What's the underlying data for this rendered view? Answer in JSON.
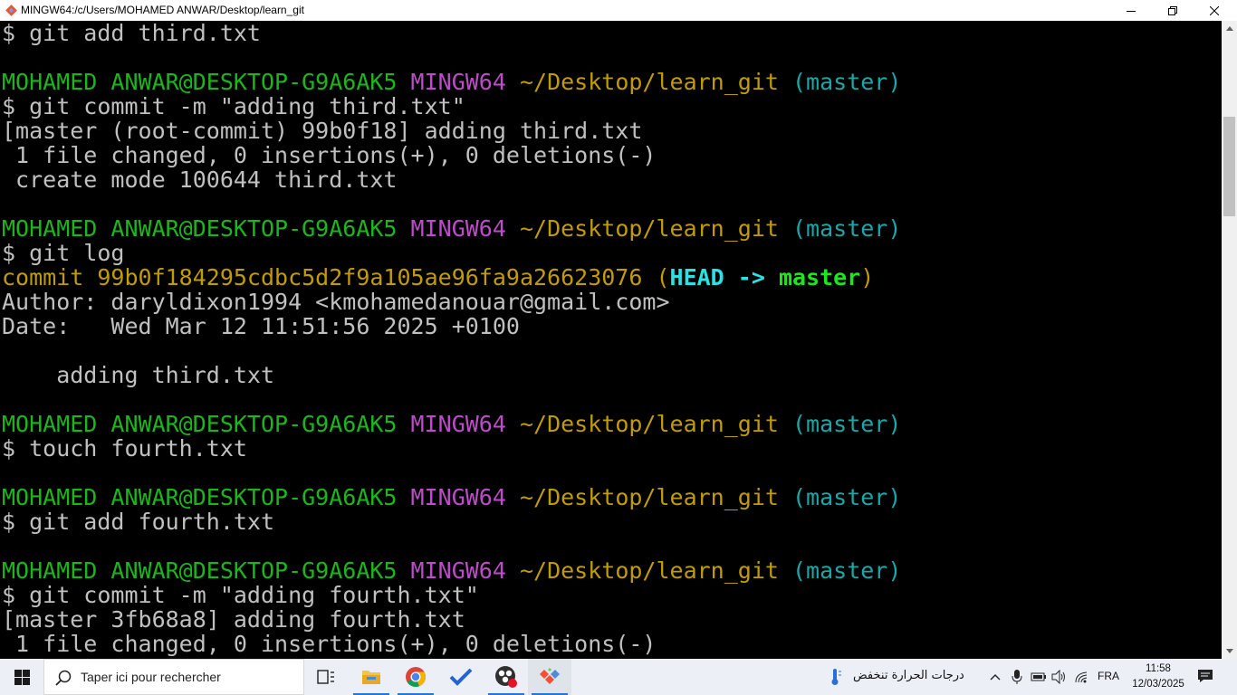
{
  "window": {
    "title": "MINGW64:/c/Users/MOHAMED ANWAR/Desktop/learn_git",
    "minimize_icon": "minimize-icon",
    "restore_icon": "restore-icon",
    "close_icon": "close-icon"
  },
  "terminal": {
    "lines": [
      [
        {
          "c": "default",
          "t": "$ git add third.txt"
        }
      ],
      [],
      [
        {
          "c": "user",
          "t": "MOHAMED ANWAR@DESKTOP-G9A6AK5 "
        },
        {
          "c": "msys",
          "t": "MINGW64 "
        },
        {
          "c": "path",
          "t": "~/Desktop/learn_git "
        },
        {
          "c": "branch",
          "t": "(master)"
        }
      ],
      [
        {
          "c": "default",
          "t": "$ git commit -m \"adding third.txt\""
        }
      ],
      [
        {
          "c": "default",
          "t": "[master (root-commit) 99b0f18] adding third.txt"
        }
      ],
      [
        {
          "c": "default",
          "t": " 1 file changed, 0 insertions(+), 0 deletions(-)"
        }
      ],
      [
        {
          "c": "default",
          "t": " create mode 100644 third.txt"
        }
      ],
      [],
      [
        {
          "c": "user",
          "t": "MOHAMED ANWAR@DESKTOP-G9A6AK5 "
        },
        {
          "c": "msys",
          "t": "MINGW64 "
        },
        {
          "c": "path",
          "t": "~/Desktop/learn_git "
        },
        {
          "c": "branch",
          "t": "(master)"
        }
      ],
      [
        {
          "c": "default",
          "t": "$ git log"
        }
      ],
      [
        {
          "c": "yellow",
          "t": "commit 99b0f184295cdbc5d2f9a105ae96fa9a26623076 ("
        },
        {
          "c": "head",
          "t": "HEAD -> "
        },
        {
          "c": "master",
          "t": "master"
        },
        {
          "c": "yellow",
          "t": ")"
        }
      ],
      [
        {
          "c": "default",
          "t": "Author: daryldixon1994 <kmohamedanouar@gmail.com>"
        }
      ],
      [
        {
          "c": "default",
          "t": "Date:   Wed Mar 12 11:51:56 2025 +0100"
        }
      ],
      [],
      [
        {
          "c": "default",
          "t": "    adding third.txt"
        }
      ],
      [],
      [
        {
          "c": "user",
          "t": "MOHAMED ANWAR@DESKTOP-G9A6AK5 "
        },
        {
          "c": "msys",
          "t": "MINGW64 "
        },
        {
          "c": "path",
          "t": "~/Desktop/learn_git "
        },
        {
          "c": "branch",
          "t": "(master)"
        }
      ],
      [
        {
          "c": "default",
          "t": "$ touch fourth.txt"
        }
      ],
      [],
      [
        {
          "c": "user",
          "t": "MOHAMED ANWAR@DESKTOP-G9A6AK5 "
        },
        {
          "c": "msys",
          "t": "MINGW64 "
        },
        {
          "c": "path",
          "t": "~/Desktop/learn_git "
        },
        {
          "c": "branch",
          "t": "(master)"
        }
      ],
      [
        {
          "c": "default",
          "t": "$ git add fourth.txt"
        }
      ],
      [],
      [
        {
          "c": "user",
          "t": "MOHAMED ANWAR@DESKTOP-G9A6AK5 "
        },
        {
          "c": "msys",
          "t": "MINGW64 "
        },
        {
          "c": "path",
          "t": "~/Desktop/learn_git "
        },
        {
          "c": "branch",
          "t": "(master)"
        }
      ],
      [
        {
          "c": "default",
          "t": "$ git commit -m \"adding fourth.txt\""
        }
      ],
      [
        {
          "c": "default",
          "t": "[master 3fb68a8] adding fourth.txt"
        }
      ],
      [
        {
          "c": "default",
          "t": " 1 file changed, 0 insertions(+), 0 deletions(-)"
        }
      ]
    ]
  },
  "taskbar": {
    "search_placeholder": "Taper ici pour rechercher",
    "apps": [
      "task-view-icon",
      "file-explorer-icon",
      "chrome-icon",
      "todo-icon",
      "obs-icon",
      "git-icon"
    ],
    "weather_text": "درجات الحرارة تنخفض",
    "language": "FRA",
    "time": "11:58",
    "date": "12/03/2025"
  },
  "colors": {
    "user": "#1cb61c",
    "msys": "#bd4cc9",
    "path": "#c19c00",
    "branch": "#1ba7a7",
    "text": "#c0c0c0"
  }
}
